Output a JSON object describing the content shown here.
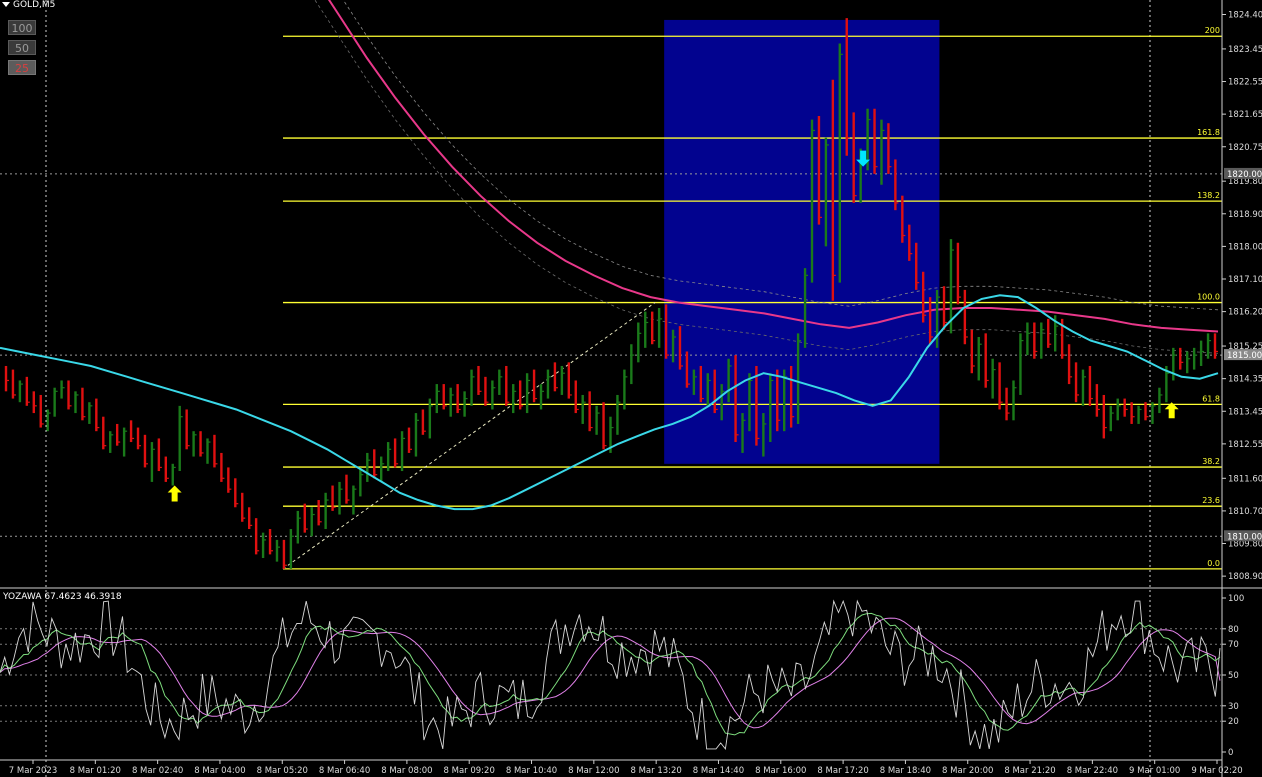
{
  "symbol": {
    "label": "GOLD,M5"
  },
  "zoom_buttons": [
    {
      "label": "100",
      "active": false
    },
    {
      "label": "50",
      "active": false
    },
    {
      "label": "25",
      "active": true
    }
  ],
  "indicator_label": "YOZAWA 67.4623 46.3918",
  "colors": {
    "background": "#000000",
    "bull": "#1a7a1a",
    "bear": "#e01010",
    "ma_fast": "#3ad8e8",
    "ma_slow": "#e8388a",
    "fib": "#ffff33",
    "highlight_box": "#02038f",
    "arrow_buy": "#ffff00",
    "arrow_sell": "#00e5ff",
    "osc_main": "#d8d8d8",
    "osc_signal1": "#7ddc7d",
    "osc_signal2": "#e080e8"
  },
  "chart_data": {
    "type": "candlestick",
    "symbol": "GOLD",
    "timeframe": "M5",
    "price_axis": {
      "range": [
        1808.6,
        1824.8
      ],
      "ticks": [
        "1824.40",
        "1823.45",
        "1822.55",
        "1821.65",
        "1820.75",
        "1819.80",
        "1818.90",
        "1818.00",
        "1817.10",
        "1816.20",
        "1815.25",
        "1814.35",
        "1813.45",
        "1812.55",
        "1811.60",
        "1810.70",
        "1809.80",
        "1808.90"
      ],
      "highlighted_labels": [
        {
          "label": "1820.00",
          "value": 1820.0
        },
        {
          "label": "1815.00",
          "value": 1815.0
        },
        {
          "label": "1810.00",
          "value": 1810.0
        }
      ]
    },
    "time_axis": {
      "labels": [
        "7 Mar 2023",
        "8 Mar 01:20",
        "8 Mar 02:40",
        "8 Mar 04:00",
        "8 Mar 05:20",
        "8 Mar 06:40",
        "8 Mar 08:00",
        "8 Mar 09:20",
        "8 Mar 10:40",
        "8 Mar 12:00",
        "8 Mar 13:20",
        "8 Mar 14:40",
        "8 Mar 16:00",
        "8 Mar 17:20",
        "8 Mar 18:40",
        "8 Mar 20:00",
        "8 Mar 21:20",
        "8 Mar 22:40",
        "9 Mar 01:00",
        "9 Mar 02:20"
      ]
    },
    "fibonacci": {
      "low": 1809.1,
      "high": 1816.45,
      "levels": [
        {
          "label": "0.0",
          "value": 1809.1
        },
        {
          "label": "23.6",
          "value": 1810.83
        },
        {
          "label": "38.2",
          "value": 1811.91
        },
        {
          "label": "61.8",
          "value": 1813.64
        },
        {
          "label": "100.0",
          "value": 1816.45
        },
        {
          "label": "138.2",
          "value": 1819.25
        },
        {
          "label": "161.8",
          "value": 1820.99
        },
        {
          "label": "200",
          "value": 1823.8
        }
      ]
    },
    "highlight_zone": {
      "price_low": 1812.0,
      "price_high": 1824.25,
      "from_label": "8 Mar 13:20",
      "to_label": "8 Mar 18:40"
    },
    "candles_ohlc": [
      [
        1814.4,
        1814.7,
        1814.0,
        1814.3
      ],
      [
        1814.3,
        1814.6,
        1813.8,
        1813.9
      ],
      [
        1814.0,
        1814.3,
        1813.7,
        1814.2
      ],
      [
        1814.2,
        1814.4,
        1813.6,
        1813.7
      ],
      [
        1813.7,
        1814.0,
        1813.4,
        1813.6
      ],
      [
        1813.6,
        1813.9,
        1813.0,
        1813.1
      ],
      [
        1813.1,
        1813.5,
        1812.9,
        1813.4
      ],
      [
        1813.4,
        1814.1,
        1813.3,
        1814.0
      ],
      [
        1814.0,
        1814.3,
        1813.8,
        1814.1
      ],
      [
        1814.1,
        1814.3,
        1813.5,
        1813.6
      ],
      [
        1813.6,
        1814.0,
        1813.4,
        1813.9
      ],
      [
        1813.9,
        1814.1,
        1813.2,
        1813.3
      ],
      [
        1813.3,
        1813.7,
        1813.1,
        1813.6
      ],
      [
        1813.6,
        1813.8,
        1812.9,
        1813.0
      ],
      [
        1813.0,
        1813.3,
        1812.4,
        1812.5
      ],
      [
        1812.5,
        1812.9,
        1812.3,
        1812.8
      ],
      [
        1812.8,
        1813.1,
        1812.5,
        1812.6
      ],
      [
        1812.6,
        1813.0,
        1812.2,
        1812.9
      ],
      [
        1812.9,
        1813.2,
        1812.6,
        1812.7
      ],
      [
        1812.7,
        1813.0,
        1812.4,
        1812.5
      ],
      [
        1812.5,
        1812.8,
        1811.9,
        1812.0
      ],
      [
        1812.0,
        1812.6,
        1811.5,
        1812.4
      ],
      [
        1812.4,
        1812.7,
        1811.8,
        1811.9
      ],
      [
        1811.9,
        1812.2,
        1811.5,
        1811.6
      ],
      [
        1811.6,
        1812.0,
        1811.4,
        1811.9
      ],
      [
        1811.9,
        1813.6,
        1811.8,
        1813.3
      ],
      [
        1813.3,
        1813.5,
        1812.4,
        1812.5
      ],
      [
        1812.5,
        1812.9,
        1812.2,
        1812.8
      ],
      [
        1812.8,
        1812.9,
        1812.2,
        1812.3
      ],
      [
        1812.3,
        1812.7,
        1812.0,
        1812.6
      ],
      [
        1812.6,
        1812.8,
        1811.9,
        1812.0
      ],
      [
        1812.0,
        1812.3,
        1811.5,
        1811.6
      ],
      [
        1811.6,
        1811.9,
        1811.2,
        1811.3
      ],
      [
        1811.3,
        1811.6,
        1810.8,
        1810.9
      ],
      [
        1810.9,
        1811.2,
        1810.4,
        1810.5
      ],
      [
        1810.5,
        1810.8,
        1810.2,
        1810.3
      ],
      [
        1810.3,
        1810.5,
        1809.5,
        1809.6
      ],
      [
        1809.6,
        1810.1,
        1809.4,
        1809.9
      ],
      [
        1809.9,
        1810.2,
        1809.5,
        1809.6
      ],
      [
        1809.6,
        1809.9,
        1809.3,
        1809.7
      ],
      [
        1809.7,
        1809.9,
        1809.1,
        1809.2
      ],
      [
        1809.2,
        1810.2,
        1809.1,
        1810.0
      ],
      [
        1810.0,
        1810.7,
        1809.8,
        1810.5
      ],
      [
        1810.5,
        1810.9,
        1810.1,
        1810.2
      ],
      [
        1810.2,
        1810.8,
        1810.0,
        1810.6
      ],
      [
        1810.6,
        1811.0,
        1810.3,
        1810.4
      ],
      [
        1810.4,
        1811.2,
        1810.2,
        1811.0
      ],
      [
        1811.0,
        1811.4,
        1810.7,
        1810.8
      ],
      [
        1810.8,
        1811.5,
        1810.6,
        1811.3
      ],
      [
        1811.3,
        1811.7,
        1810.9,
        1811.0
      ],
      [
        1811.0,
        1811.4,
        1810.6,
        1811.3
      ],
      [
        1811.3,
        1811.9,
        1811.1,
        1811.7
      ],
      [
        1811.7,
        1812.3,
        1811.5,
        1812.1
      ],
      [
        1812.1,
        1812.4,
        1811.6,
        1811.7
      ],
      [
        1811.7,
        1812.2,
        1811.5,
        1812.0
      ],
      [
        1812.0,
        1812.6,
        1811.8,
        1812.4
      ],
      [
        1812.4,
        1812.7,
        1811.9,
        1812.0
      ],
      [
        1812.0,
        1812.9,
        1811.8,
        1812.7
      ],
      [
        1812.7,
        1813.0,
        1812.3,
        1812.4
      ],
      [
        1812.4,
        1813.4,
        1812.2,
        1813.2
      ],
      [
        1813.2,
        1813.5,
        1812.8,
        1812.9
      ],
      [
        1812.9,
        1813.8,
        1812.7,
        1813.6
      ],
      [
        1813.6,
        1814.2,
        1813.4,
        1814.0
      ],
      [
        1814.0,
        1814.2,
        1813.5,
        1813.6
      ],
      [
        1813.6,
        1814.1,
        1813.3,
        1813.9
      ],
      [
        1813.9,
        1814.2,
        1813.4,
        1813.5
      ],
      [
        1813.5,
        1814.0,
        1813.3,
        1813.8
      ],
      [
        1813.8,
        1814.6,
        1813.6,
        1814.4
      ],
      [
        1814.4,
        1814.7,
        1813.9,
        1814.0
      ],
      [
        1814.0,
        1814.4,
        1813.6,
        1813.7
      ],
      [
        1813.7,
        1814.3,
        1813.5,
        1814.1
      ],
      [
        1814.1,
        1814.6,
        1813.9,
        1814.4
      ],
      [
        1814.4,
        1814.7,
        1813.6,
        1813.7
      ],
      [
        1813.7,
        1814.2,
        1813.4,
        1814.0
      ],
      [
        1814.0,
        1814.3,
        1813.5,
        1813.6
      ],
      [
        1813.6,
        1814.5,
        1813.4,
        1814.3
      ],
      [
        1814.3,
        1814.6,
        1813.7,
        1813.8
      ],
      [
        1813.8,
        1814.2,
        1813.5,
        1814.0
      ],
      [
        1814.0,
        1814.6,
        1813.8,
        1814.4
      ],
      [
        1814.4,
        1814.8,
        1814.0,
        1814.1
      ],
      [
        1814.1,
        1814.7,
        1813.9,
        1814.5
      ],
      [
        1814.5,
        1814.8,
        1813.8,
        1813.9
      ],
      [
        1813.9,
        1814.3,
        1813.4,
        1813.5
      ],
      [
        1813.5,
        1813.9,
        1813.1,
        1813.7
      ],
      [
        1813.7,
        1814.0,
        1812.9,
        1813.0
      ],
      [
        1813.0,
        1813.6,
        1812.8,
        1813.4
      ],
      [
        1813.4,
        1813.7,
        1812.4,
        1812.5
      ],
      [
        1812.5,
        1813.3,
        1812.3,
        1813.0
      ],
      [
        1813.0,
        1813.9,
        1812.8,
        1813.7
      ],
      [
        1813.7,
        1814.6,
        1813.5,
        1814.4
      ],
      [
        1814.4,
        1815.3,
        1814.2,
        1815.0
      ],
      [
        1815.0,
        1815.9,
        1814.8,
        1815.6
      ],
      [
        1815.6,
        1816.2,
        1815.2,
        1815.9
      ],
      [
        1815.9,
        1816.2,
        1815.3,
        1815.4
      ],
      [
        1815.4,
        1816.3,
        1815.2,
        1816.0
      ],
      [
        1816.0,
        1816.4,
        1814.9,
        1815.0
      ],
      [
        1815.0,
        1815.7,
        1814.8,
        1815.5
      ],
      [
        1815.5,
        1815.8,
        1814.6,
        1814.7
      ],
      [
        1814.7,
        1815.1,
        1814.1,
        1814.2
      ],
      [
        1814.2,
        1814.6,
        1813.9,
        1814.4
      ],
      [
        1814.4,
        1814.7,
        1813.7,
        1813.8
      ],
      [
        1813.8,
        1814.5,
        1813.6,
        1814.3
      ],
      [
        1814.3,
        1814.6,
        1813.4,
        1813.5
      ],
      [
        1813.5,
        1814.2,
        1813.2,
        1814.0
      ],
      [
        1814.0,
        1814.9,
        1813.7,
        1814.7
      ],
      [
        1814.7,
        1815.0,
        1812.6,
        1812.8
      ],
      [
        1812.8,
        1813.4,
        1812.3,
        1813.2
      ],
      [
        1813.2,
        1814.5,
        1812.9,
        1814.3
      ],
      [
        1814.3,
        1814.7,
        1812.5,
        1812.7
      ],
      [
        1812.7,
        1813.4,
        1812.2,
        1813.1
      ],
      [
        1813.1,
        1814.5,
        1812.6,
        1814.3
      ],
      [
        1814.3,
        1814.6,
        1812.9,
        1813.2
      ],
      [
        1813.2,
        1814.6,
        1812.9,
        1814.4
      ],
      [
        1814.4,
        1814.7,
        1813.0,
        1813.3
      ],
      [
        1813.3,
        1815.6,
        1813.1,
        1815.4
      ],
      [
        1815.4,
        1817.4,
        1815.2,
        1817.2
      ],
      [
        1817.2,
        1821.5,
        1817.0,
        1821.2
      ],
      [
        1821.2,
        1821.6,
        1818.6,
        1818.8
      ],
      [
        1818.8,
        1821.0,
        1818.0,
        1820.8
      ],
      [
        1820.8,
        1822.6,
        1816.5,
        1817.2
      ],
      [
        1817.2,
        1823.6,
        1817.0,
        1823.3
      ],
      [
        1823.3,
        1824.3,
        1820.5,
        1821.0
      ],
      [
        1821.0,
        1821.7,
        1819.2,
        1819.4
      ],
      [
        1819.4,
        1820.7,
        1819.2,
        1820.5
      ],
      [
        1820.5,
        1821.8,
        1820.1,
        1821.5
      ],
      [
        1821.5,
        1821.8,
        1820.0,
        1820.2
      ],
      [
        1820.2,
        1821.5,
        1819.7,
        1821.2
      ],
      [
        1821.2,
        1821.4,
        1820.0,
        1820.2
      ],
      [
        1820.2,
        1820.4,
        1819.0,
        1819.2
      ],
      [
        1819.2,
        1819.4,
        1818.1,
        1818.3
      ],
      [
        1818.3,
        1818.6,
        1817.6,
        1817.8
      ],
      [
        1817.8,
        1818.1,
        1816.8,
        1817.0
      ],
      [
        1817.0,
        1817.3,
        1815.9,
        1816.1
      ],
      [
        1816.1,
        1816.6,
        1815.3,
        1815.5
      ],
      [
        1815.5,
        1816.8,
        1815.2,
        1816.6
      ],
      [
        1816.6,
        1816.9,
        1815.7,
        1815.9
      ],
      [
        1815.9,
        1818.2,
        1815.6,
        1817.9
      ],
      [
        1817.9,
        1818.1,
        1816.4,
        1816.6
      ],
      [
        1816.6,
        1816.8,
        1815.3,
        1815.5
      ],
      [
        1815.5,
        1815.7,
        1814.5,
        1814.7
      ],
      [
        1814.7,
        1815.5,
        1814.3,
        1815.3
      ],
      [
        1815.3,
        1815.6,
        1814.1,
        1814.3
      ],
      [
        1814.3,
        1814.9,
        1813.8,
        1814.6
      ],
      [
        1814.6,
        1814.8,
        1813.5,
        1813.7
      ],
      [
        1813.7,
        1814.1,
        1813.2,
        1813.4
      ],
      [
        1813.4,
        1814.3,
        1813.2,
        1814.1
      ],
      [
        1814.1,
        1815.6,
        1813.9,
        1815.4
      ],
      [
        1815.4,
        1815.9,
        1815.0,
        1815.6
      ],
      [
        1815.6,
        1815.9,
        1814.9,
        1815.1
      ],
      [
        1815.1,
        1815.9,
        1814.9,
        1815.7
      ],
      [
        1815.7,
        1816.0,
        1815.2,
        1815.3
      ],
      [
        1815.3,
        1816.1,
        1815.1,
        1815.8
      ],
      [
        1815.8,
        1816.0,
        1814.9,
        1815.0
      ],
      [
        1815.0,
        1815.3,
        1814.2,
        1814.4
      ],
      [
        1814.4,
        1814.8,
        1813.7,
        1813.9
      ],
      [
        1813.9,
        1814.6,
        1813.6,
        1814.4
      ],
      [
        1814.4,
        1814.7,
        1813.6,
        1813.8
      ],
      [
        1813.8,
        1814.2,
        1813.3,
        1813.5
      ],
      [
        1813.5,
        1813.9,
        1812.7,
        1813.0
      ],
      [
        1813.0,
        1813.6,
        1812.9,
        1813.4
      ],
      [
        1813.4,
        1813.8,
        1813.2,
        1813.6
      ],
      [
        1813.6,
        1813.8,
        1813.3,
        1813.5
      ],
      [
        1813.5,
        1813.7,
        1813.1,
        1813.3
      ],
      [
        1813.3,
        1813.6,
        1813.1,
        1813.5
      ],
      [
        1813.5,
        1813.7,
        1813.2,
        1813.3
      ],
      [
        1813.3,
        1813.7,
        1813.1,
        1813.6
      ],
      [
        1813.6,
        1814.1,
        1813.4,
        1813.9
      ],
      [
        1813.9,
        1814.7,
        1813.7,
        1814.5
      ],
      [
        1814.5,
        1815.2,
        1814.3,
        1815.0
      ],
      [
        1815.0,
        1815.2,
        1814.6,
        1814.8
      ],
      [
        1814.8,
        1815.1,
        1814.5,
        1814.9
      ],
      [
        1814.9,
        1815.2,
        1814.6,
        1815.0
      ],
      [
        1815.0,
        1815.4,
        1814.7,
        1815.1
      ],
      [
        1815.1,
        1815.6,
        1814.9,
        1815.4
      ],
      [
        1815.4,
        1815.6,
        1814.9,
        1815.1
      ]
    ],
    "ma_fast_values": [
      1815.2,
      1815.1,
      1815.0,
      1814.9,
      1814.8,
      1814.7,
      1814.55,
      1814.4,
      1814.25,
      1814.1,
      1813.95,
      1813.8,
      1813.65,
      1813.5,
      1813.3,
      1813.1,
      1812.9,
      1812.65,
      1812.4,
      1812.1,
      1811.8,
      1811.5,
      1811.2,
      1811.0,
      1810.85,
      1810.75,
      1810.75,
      1810.85,
      1811.05,
      1811.3,
      1811.55,
      1811.8,
      1812.05,
      1812.3,
      1812.55,
      1812.75,
      1812.95,
      1813.1,
      1813.3,
      1813.6,
      1814.0,
      1814.3,
      1814.5,
      1814.4,
      1814.25,
      1814.1,
      1813.95,
      1813.75,
      1813.6,
      1813.75,
      1814.4,
      1815.2,
      1815.8,
      1816.3,
      1816.55,
      1816.65,
      1816.6,
      1816.3,
      1815.95,
      1815.65,
      1815.4,
      1815.25,
      1815.1,
      1814.85,
      1814.6,
      1814.4,
      1814.35,
      1814.5
    ],
    "ma_slow_values": [
      1833.5,
      1832.2,
      1830.9,
      1829.6,
      1828.2,
      1826.9,
      1825.6,
      1824.4,
      1823.2,
      1822.1,
      1821.1,
      1820.2,
      1819.4,
      1818.7,
      1818.1,
      1817.6,
      1817.2,
      1816.85,
      1816.6,
      1816.45,
      1816.35,
      1816.25,
      1816.15,
      1816.0,
      1815.85,
      1815.75,
      1815.9,
      1816.1,
      1816.25,
      1816.3,
      1816.3,
      1816.25,
      1816.2,
      1816.1,
      1816.0,
      1815.85,
      1815.75,
      1815.7,
      1815.65
    ],
    "indicator": {
      "name": "YOZAWA",
      "values": [
        67.4623,
        46.3918
      ],
      "range": [
        0,
        100
      ],
      "levels": [
        100,
        80,
        70,
        50,
        30,
        20,
        0
      ]
    },
    "signals": [
      {
        "type": "buy",
        "time_label": "8 Mar 02:40",
        "price": 1811.4
      },
      {
        "type": "sell",
        "time_label": "8 Mar 17:20",
        "price": 1820.2
      },
      {
        "type": "buy",
        "time_label": "9 Mar 01:00",
        "price": 1813.7
      }
    ]
  }
}
